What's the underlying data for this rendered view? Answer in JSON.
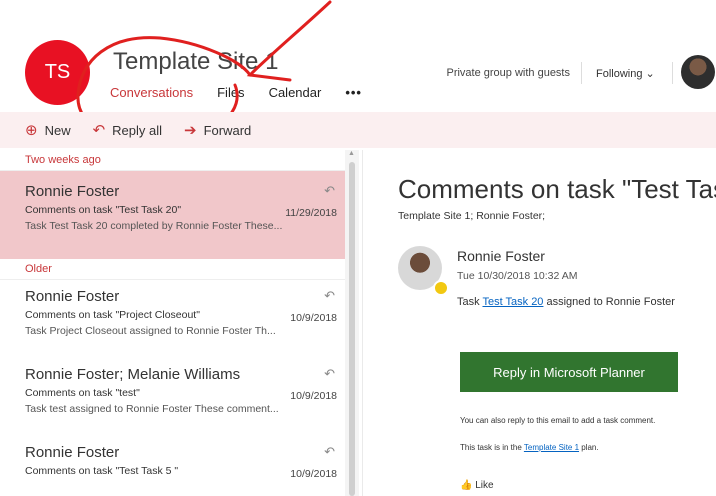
{
  "site": {
    "initials": "TS",
    "title": "Template Site 1",
    "nav": [
      "Conversations",
      "Files",
      "Calendar",
      "•••"
    ],
    "group_info": "Private group with guests",
    "following": "Following ⌄",
    "accent": "#c8373a",
    "avatar_color": "#e81123"
  },
  "toolbar": {
    "new": "New",
    "reply_all": "Reply all",
    "forward": "Forward",
    "new_icon": "plus-circle-icon",
    "reply_icon": "reply-icon",
    "forward_icon": "arrow-right-icon"
  },
  "list": {
    "groups": [
      "Two weeks ago",
      "Older"
    ],
    "messages": [
      {
        "from": "Ronnie Foster",
        "subject": "Comments on task \"Test Task 20\"",
        "date": "11/29/2018",
        "preview": "Task Test Task 20 completed by Ronnie Foster These..."
      },
      {
        "from": "Ronnie Foster",
        "subject": "Comments on task \"Project Closeout\"",
        "date": "10/9/2018",
        "preview": "Task Project Closeout assigned to Ronnie Foster Th..."
      },
      {
        "from": "Ronnie Foster; Melanie Williams",
        "subject": "Comments on task \"test\"",
        "date": "10/9/2018",
        "preview": "Task test assigned to Ronnie Foster These comment..."
      },
      {
        "from": "Ronnie Foster",
        "subject": "Comments on task \"Test Task 5 \"",
        "date": "10/9/2018",
        "preview": ""
      }
    ]
  },
  "mail": {
    "subject": "Comments on task \"Test Tas",
    "to": "Template Site 1; Ronnie Foster;",
    "sender": "Ronnie Foster",
    "sent": "Tue 10/30/2018 10:32 AM",
    "task_prefix": "Task ",
    "task_link": "Test Task 20",
    "task_suffix": " assigned to Ronnie Foster",
    "button": "Reply in Microsoft Planner",
    "button_color": "#31752f",
    "note1": "You can also reply to this email to add a task comment.",
    "note2_prefix": "This task is in the ",
    "note2_link": "Template Site 1",
    "note2_suffix": " plan.",
    "like": "Like"
  }
}
